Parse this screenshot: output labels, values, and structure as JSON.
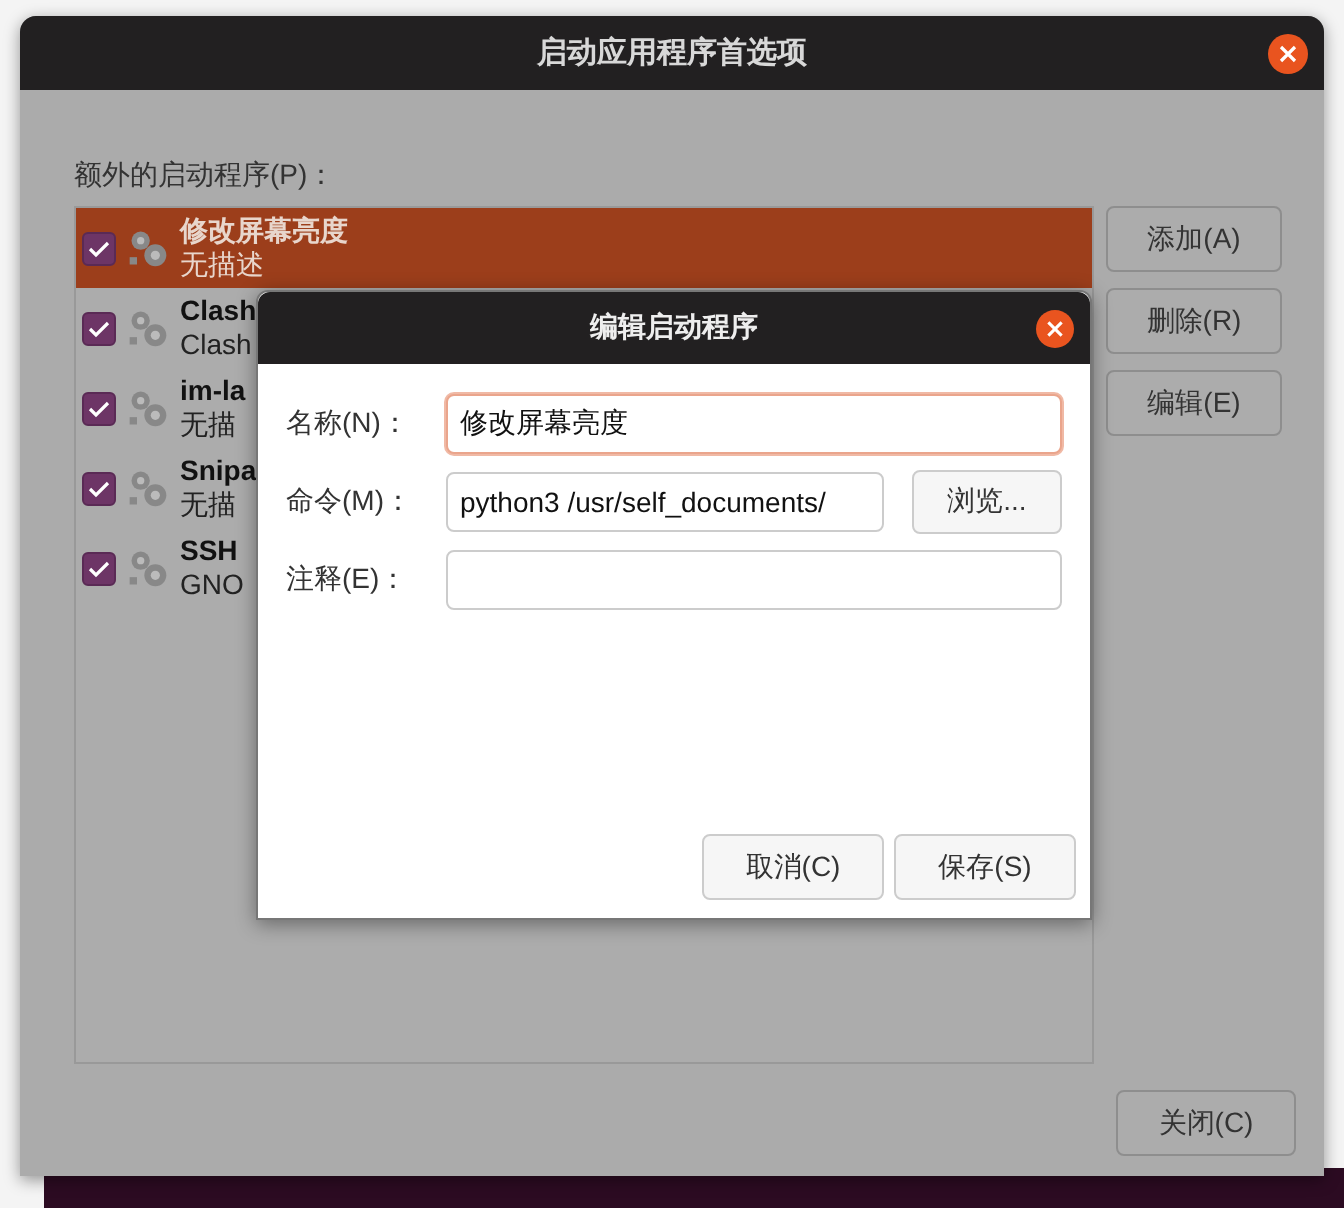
{
  "window": {
    "title": "启动应用程序首选项",
    "list_label": "额外的启动程序(P)："
  },
  "programs": [
    {
      "name": "修改屏幕亮度",
      "description": "无描述",
      "checked": true,
      "selected": true
    },
    {
      "name": "Clash",
      "description": "Clash",
      "checked": true,
      "selected": false
    },
    {
      "name": "im-la",
      "description": "无描",
      "checked": true,
      "selected": false
    },
    {
      "name": "Snipa",
      "description": "无描",
      "checked": true,
      "selected": false
    },
    {
      "name": "SSH",
      "description": "GNO",
      "checked": true,
      "selected": false
    }
  ],
  "side_buttons": [
    "添加(A)",
    "删除(R)",
    "编辑(E)"
  ],
  "close_button": "关闭(C)",
  "dialog": {
    "title": "编辑启动程序",
    "fields": [
      {
        "label": "名称(N)：",
        "value": "修改屏幕亮度",
        "focused": true
      },
      {
        "label": "命令(M)：",
        "value": "python3 /usr/self_documents/",
        "focused": false,
        "button": "浏览..."
      },
      {
        "label": "注释(E)：",
        "focused": false
      }
    ],
    "buttons": [
      "取消(C)",
      "保存(S)"
    ]
  }
}
